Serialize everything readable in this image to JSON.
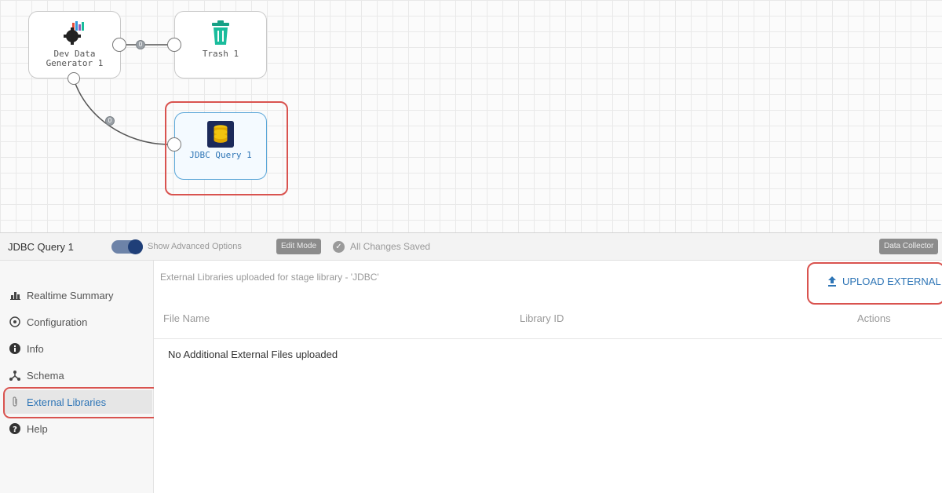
{
  "canvas": {
    "nodes": [
      {
        "id": "dev",
        "label": "Dev Data Generator 1",
        "icon": "dev-data-generator-icon"
      },
      {
        "id": "trash",
        "label": "Trash 1",
        "icon": "trash-icon"
      },
      {
        "id": "jdbc",
        "label": "JDBC Query 1",
        "icon": "database-icon",
        "selected": true
      }
    ],
    "links": [
      {
        "from": "dev",
        "to": "trash",
        "marker": "0"
      },
      {
        "from": "dev",
        "to": "jdbc",
        "marker": "0"
      }
    ]
  },
  "toolbar": {
    "stage_name": "JDBC Query 1",
    "toggle_label": "Show Advanced Options",
    "edit_mode": "Edit Mode",
    "saved_status": "All Changes Saved",
    "collector_badge": "Data Collector"
  },
  "sidebar": {
    "items": [
      {
        "label": "Realtime Summary",
        "icon": "bar-chart-icon"
      },
      {
        "label": "Configuration",
        "icon": "configuration-icon"
      },
      {
        "label": "Info",
        "icon": "info-icon"
      },
      {
        "label": "Schema",
        "icon": "schema-icon"
      },
      {
        "label": "External Libraries",
        "icon": "paperclip-icon",
        "active": true
      },
      {
        "label": "Help",
        "icon": "help-icon"
      }
    ]
  },
  "main": {
    "title": "External Libraries uploaded for stage library - 'JDBC'",
    "upload_label": "UPLOAD EXTERNAL",
    "columns": [
      "File Name",
      "Library ID",
      "Actions"
    ],
    "empty_message": "No Additional External Files uploaded"
  },
  "colors": {
    "accent": "#2e75b6",
    "highlight": "#d9534f",
    "toggle_on": "#1f3f78"
  }
}
